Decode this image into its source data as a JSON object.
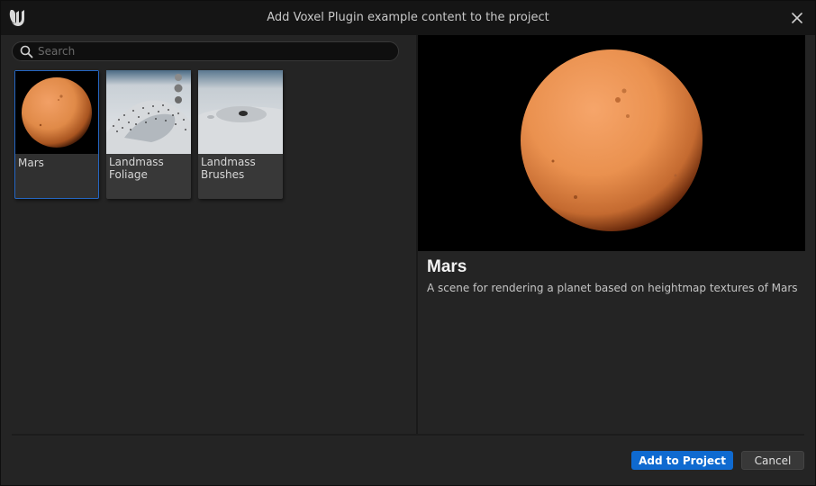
{
  "window": {
    "title": "Add Voxel Plugin example content to the project",
    "logo_icon": "unreal-engine-logo-icon",
    "close_icon": "close-icon"
  },
  "search": {
    "placeholder": "Search",
    "value": "",
    "icon": "search-icon"
  },
  "examples": [
    {
      "label": "Mars",
      "selected": true,
      "thumbnail": "mars-planet-thumbnail"
    },
    {
      "label": "Landmass Foliage",
      "selected": false,
      "thumbnail": "landmass-foliage-thumbnail"
    },
    {
      "label": "Landmass Brushes",
      "selected": false,
      "thumbnail": "landmass-brushes-thumbnail"
    }
  ],
  "details": {
    "title": "Mars",
    "description": "A scene for rendering a planet based on heightmap textures of Mars",
    "preview": "mars-planet-preview"
  },
  "footer": {
    "primary_label": "Add to Project",
    "cancel_label": "Cancel"
  },
  "colors": {
    "accent": "#0f6ad0",
    "selection_border": "#2566c2",
    "mars_orange": "#e08a48"
  }
}
